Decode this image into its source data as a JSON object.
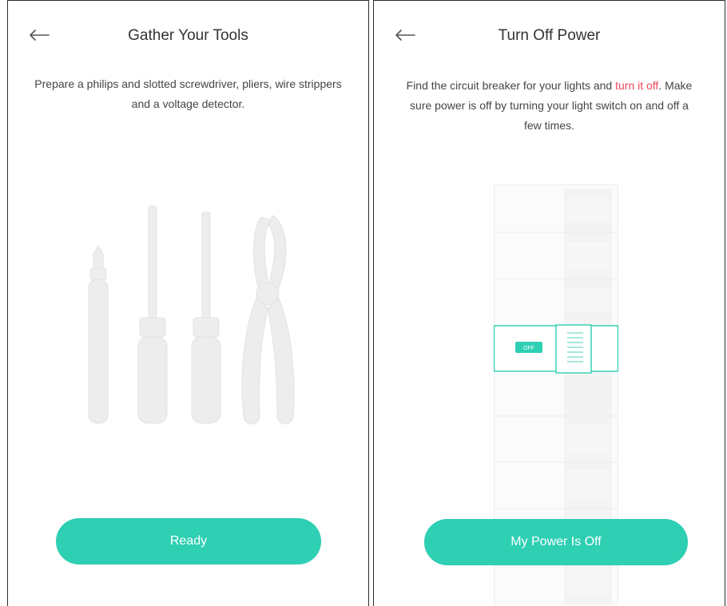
{
  "screens": [
    {
      "title": "Gather Your Tools",
      "description": "Prepare a philips and slotted screwdriver, pliers, wire strippers and a voltage detector.",
      "button_label": "Ready"
    },
    {
      "title": "Turn Off Power",
      "description_before": "Find the circuit breaker for your lights and ",
      "description_highlight": "turn it off",
      "description_after": ". Make sure power is off by turning your light switch on and off a few times.",
      "switch_label": "OFF",
      "button_label": "My Power Is Off"
    }
  ],
  "colors": {
    "accent": "#2ecfb3",
    "highlight": "#f0465a",
    "illustration": "#eeeeee",
    "text": "#444444"
  },
  "icons": {
    "back": "arrow-left-icon",
    "tools": "tools-illustration-icon",
    "breaker": "breaker-panel-icon"
  }
}
